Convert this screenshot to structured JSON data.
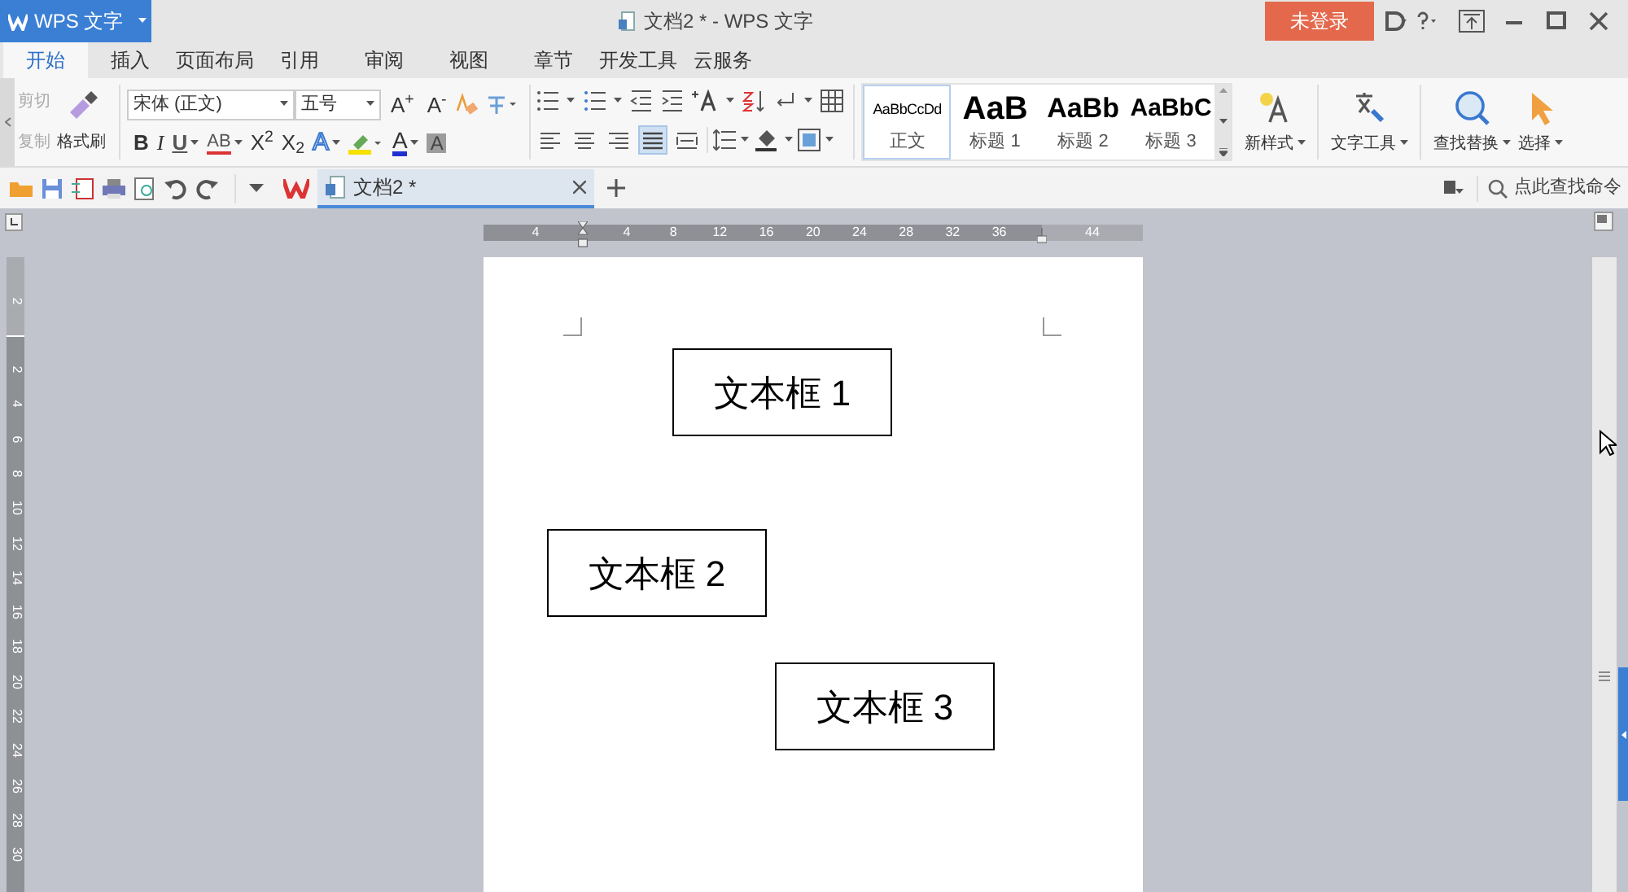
{
  "app_menu": {
    "label": "WPS 文字"
  },
  "window": {
    "title": "文档2 * - WPS 文字"
  },
  "account": {
    "label": "未登录"
  },
  "tabs": [
    {
      "label": "开始",
      "selected": true
    },
    {
      "label": "插入",
      "selected": false
    },
    {
      "label": "页面布局",
      "selected": false
    },
    {
      "label": "引用",
      "selected": false
    },
    {
      "label": "审阅",
      "selected": false
    },
    {
      "label": "视图",
      "selected": false
    },
    {
      "label": "章节",
      "selected": false
    },
    {
      "label": "开发工具",
      "selected": false
    },
    {
      "label": "云服务",
      "selected": false
    }
  ],
  "clipboard": [
    {
      "label": "剪切",
      "disabled": true
    },
    {
      "label": "复制",
      "disabled": true
    }
  ],
  "format_painter": {
    "label": "格式刷"
  },
  "font_name": "宋体 (正文)",
  "font_size": "五号",
  "font_size_buttons": [
    {
      "label": "A$^{+}$"
    },
    {
      "label": "A$^{-}$"
    }
  ],
  "font_style_buttons": [
    {
      "kind": "bold",
      "label": "B",
      "dropdown": false
    },
    {
      "kind": "italic",
      "label": "I",
      "dropdown": false
    },
    {
      "kind": "underline",
      "label": "U",
      "dropdown": true
    },
    {
      "kind": "strike",
      "label": "AB",
      "dropdown": true
    },
    {
      "kind": "plain",
      "label": "X$^{2}$",
      "dropdown": false
    },
    {
      "kind": "plain",
      "label": "X$_{2}$",
      "dropdown": false
    },
    {
      "kind": "effect",
      "label": "A",
      "dropdown": true
    },
    {
      "kind": "color",
      "label": "A",
      "dropdown": true
    },
    {
      "kind": "shading",
      "label": "A",
      "dropdown": false
    }
  ],
  "alignment": [
    {
      "kind": "left",
      "selected": false
    },
    {
      "kind": "center",
      "selected": false
    },
    {
      "kind": "right",
      "selected": false
    },
    {
      "kind": "justify",
      "selected": true
    },
    {
      "kind": "distributed",
      "selected": false
    }
  ],
  "styles": [
    {
      "preview": "AaBbCcDd",
      "label": "正文",
      "kind": "normal",
      "selected": true
    },
    {
      "preview": "AaB",
      "label": "标题 1",
      "kind": "h1",
      "selected": false
    },
    {
      "preview": "AaBb",
      "label": "标题 2",
      "kind": "h2",
      "selected": false
    },
    {
      "preview": "AaBbC",
      "label": "标题 3",
      "kind": "h3",
      "selected": false
    }
  ],
  "tools": [
    {
      "kind": "new_style",
      "label": "新样式"
    },
    {
      "kind": "text_tools",
      "label": "文字工具"
    },
    {
      "kind": "find",
      "label": "查找替换"
    },
    {
      "kind": "select",
      "label": "选择"
    }
  ],
  "document_tabs": [
    {
      "label": "文档2 *",
      "selected": true
    }
  ],
  "command_search": {
    "placeholder": "点此查找命令"
  },
  "horizontal_ruler": [
    "4",
    "4",
    "8",
    "12",
    "16",
    "20",
    "24",
    "28",
    "32",
    "36",
    "44"
  ],
  "vertical_ruler": [
    "2",
    "2",
    "4",
    "6",
    "8",
    "10",
    "12",
    "14",
    "16",
    "18",
    "20",
    "22",
    "24",
    "26",
    "28",
    "30"
  ],
  "text_boxes": [
    {
      "text": "文本框 1"
    },
    {
      "text": "文本框 2"
    },
    {
      "text": "文本框 3"
    }
  ]
}
